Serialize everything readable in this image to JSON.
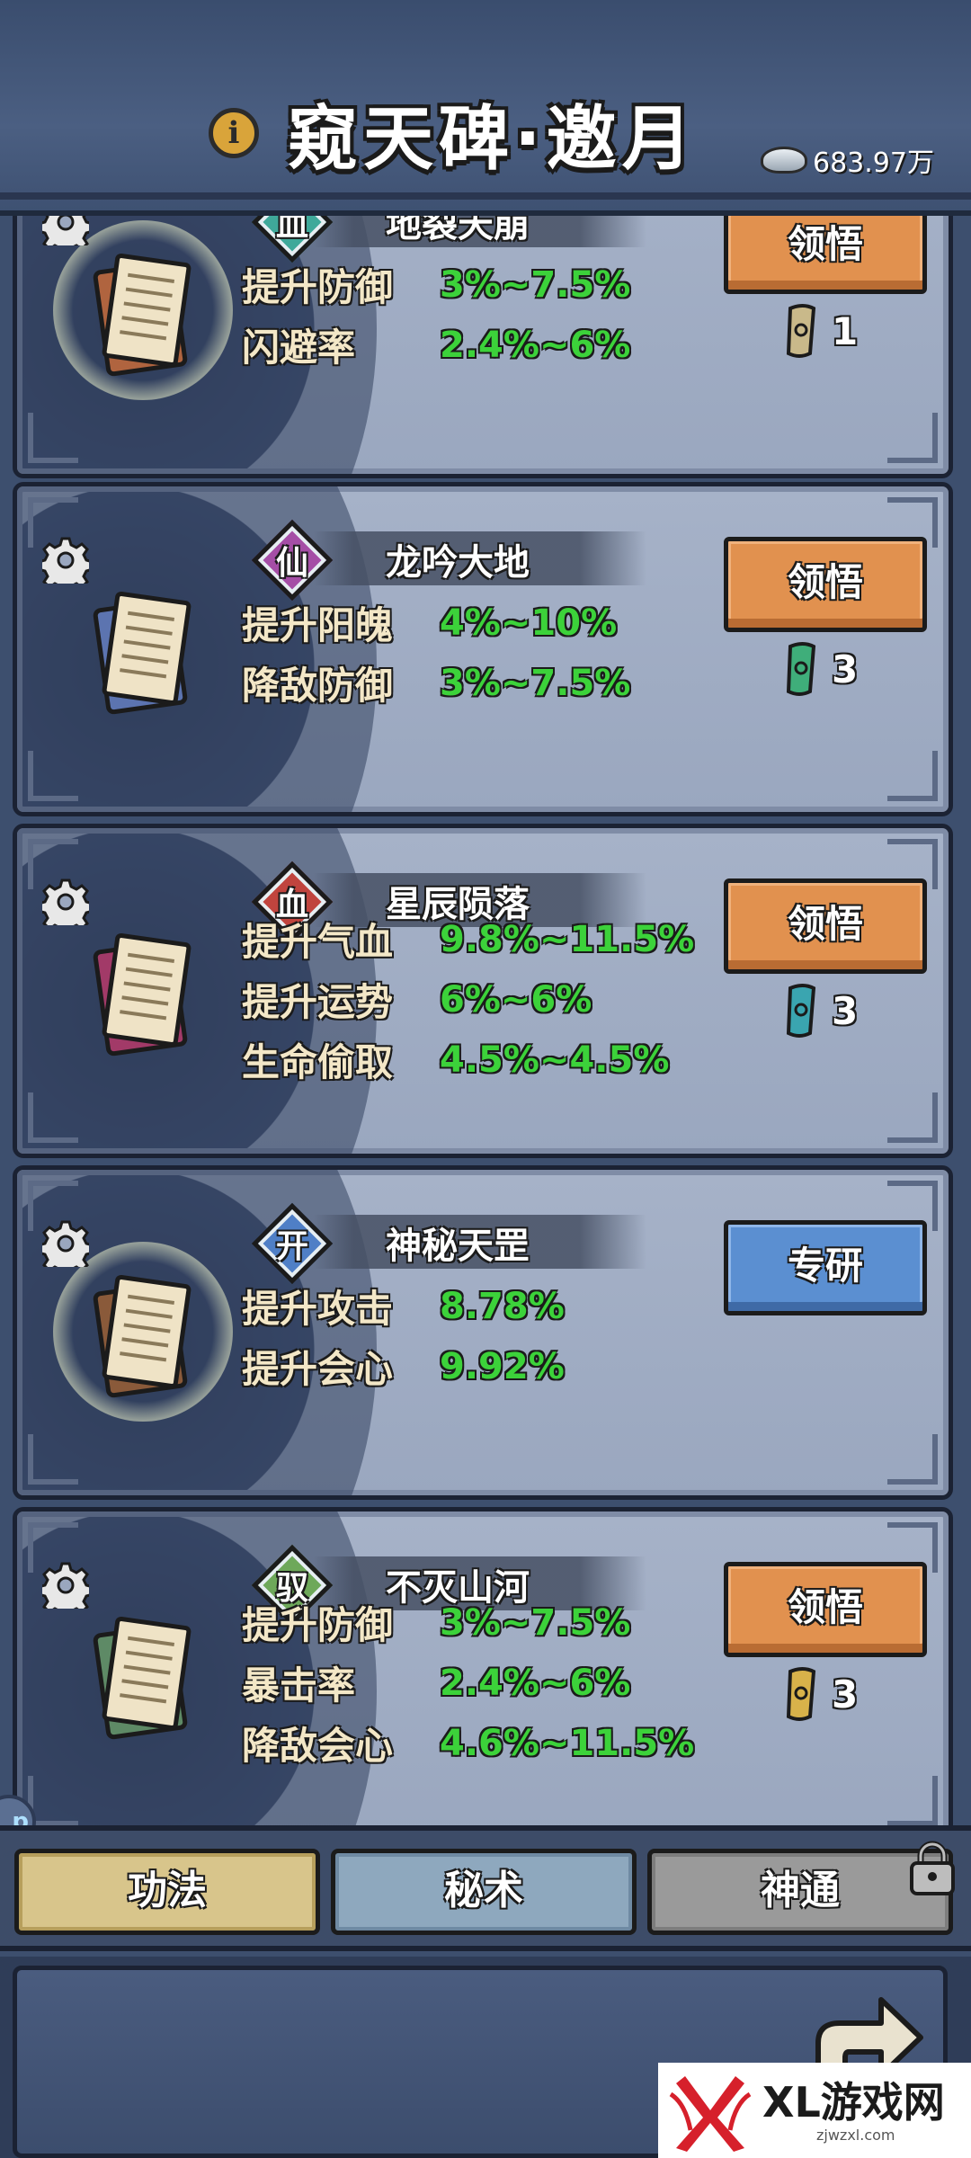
{
  "header": {
    "title": "窥天碑·邀月",
    "currency_value": "683.97万"
  },
  "cards": [
    {
      "badge": "血",
      "badge_color": "#3fa99a",
      "scroll_color": "#b0643f",
      "name": "地裂天崩",
      "stats": [
        {
          "label": "提升防御",
          "value": "3%~7.5%"
        },
        {
          "label": "闪避率",
          "value": "2.4%~6%"
        }
      ],
      "action": "领悟",
      "action_style": "orange",
      "cost_count": "1",
      "cost_color": "#c9b98a"
    },
    {
      "badge": "仙",
      "badge_color": "#a54ea6",
      "scroll_color": "#5c74b0",
      "name": "龙吟大地",
      "stats": [
        {
          "label": "提升阳魄",
          "value": "4%~10%"
        },
        {
          "label": "降敌防御",
          "value": "3%~7.5%"
        }
      ],
      "action": "领悟",
      "action_style": "orange",
      "cost_count": "3",
      "cost_color": "#3fae7a"
    },
    {
      "badge": "血",
      "badge_color": "#c0443e",
      "scroll_color": "#a23a68",
      "name": "星辰陨落",
      "stats": [
        {
          "label": "提升气血",
          "value": "9.8%~11.5%"
        },
        {
          "label": "提升运势",
          "value": "6%~6%"
        },
        {
          "label": "生命偷取",
          "value": "4.5%~4.5%"
        }
      ],
      "action": "领悟",
      "action_style": "orange",
      "cost_count": "3",
      "cost_color": "#3aa5b0"
    },
    {
      "badge": "开",
      "badge_color": "#4f7fc6",
      "scroll_color": "#8a5a3a",
      "name": "神秘天罡",
      "stats": [
        {
          "label": "提升攻击",
          "value": "8.78%"
        },
        {
          "label": "提升会心",
          "value": "9.92%"
        }
      ],
      "action": "专研",
      "action_style": "blue",
      "cost_count": "",
      "cost_color": ""
    },
    {
      "badge": "驭",
      "badge_color": "#6ea85a",
      "scroll_color": "#5e8a66",
      "name": "不灭山河",
      "stats": [
        {
          "label": "提升防御",
          "value": "3%~7.5%"
        },
        {
          "label": "暴击率",
          "value": "2.4%~6%"
        },
        {
          "label": "降敌会心",
          "value": "4.6%~11.5%"
        }
      ],
      "action": "领悟",
      "action_style": "orange",
      "cost_count": "3",
      "cost_color": "#d8b24a"
    }
  ],
  "tabs": {
    "tab1": "功法",
    "tab2": "秘术",
    "tab3": "神通"
  },
  "side_orb_text": "p",
  "watermark": {
    "brand": "XL游戏网",
    "url": "zjwzxl.com"
  }
}
